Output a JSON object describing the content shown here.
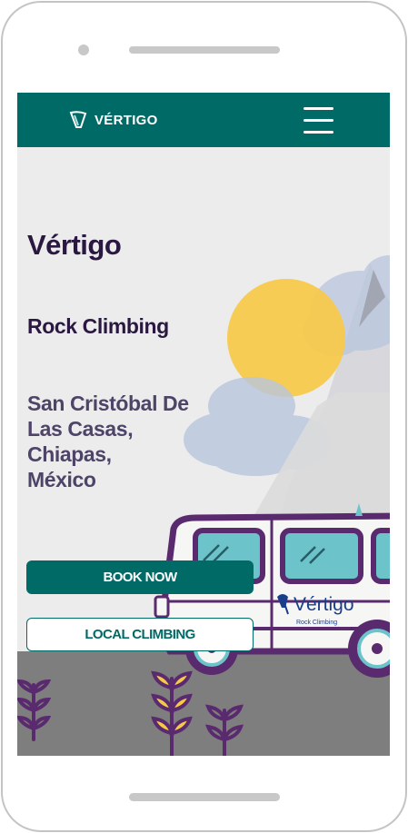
{
  "header": {
    "brand_name": "VÉRTIGO",
    "logo_icon": "vertigo-logo-icon",
    "menu_icon": "hamburger-menu-icon"
  },
  "hero": {
    "title": "Vértigo",
    "subtitle": "Rock Climbing",
    "location_lines": [
      "San Cristóbal De",
      "Las Casas,",
      "Chiapas,",
      "México"
    ]
  },
  "actions": {
    "book_now_label": "BOOK NOW",
    "local_climbing_label": "LOCAL CLIMBING"
  },
  "illustration": {
    "van_brand": "Vértigo",
    "van_tagline": "Rock Climbing"
  },
  "colors": {
    "brand_teal": "#006a66",
    "title_purple": "#2a1840",
    "location_purple": "#4e4468",
    "sun_yellow": "#f7c948",
    "van_purple": "#5a2a6e",
    "window_teal": "#6cc3ca"
  }
}
